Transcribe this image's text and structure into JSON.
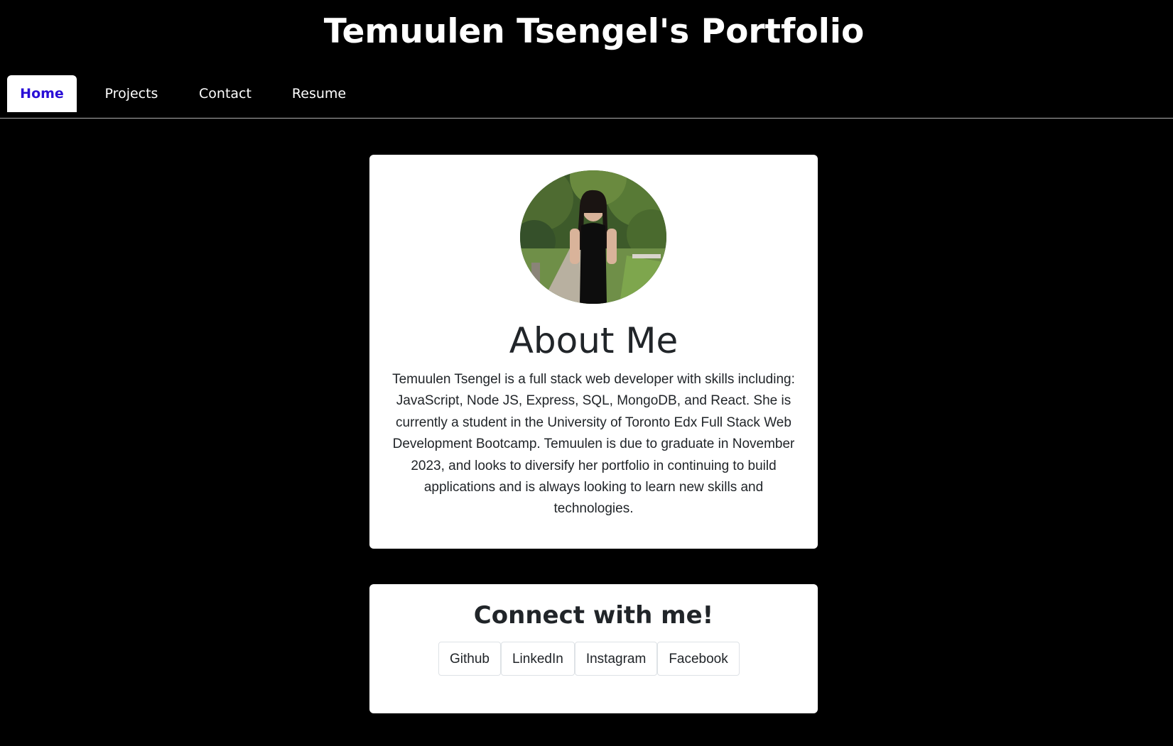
{
  "header": {
    "title": "Temuulen Tsengel's Portfolio"
  },
  "nav": {
    "tabs": [
      {
        "label": "Home",
        "active": true
      },
      {
        "label": "Projects",
        "active": false
      },
      {
        "label": "Contact",
        "active": false
      },
      {
        "label": "Resume",
        "active": false
      }
    ]
  },
  "about": {
    "heading": "About Me",
    "text": "Temuulen Tsengel is a full stack web developer with skills including: JavaScript, Node JS, Express, SQL, MongoDB, and React. She is currently a student in the University of Toronto Edx Full Stack Web Development Bootcamp. Temuulen is due to graduate in November 2023, and looks to diversify her portfolio in continuing to build applications and is always looking to learn new skills and technologies."
  },
  "connect": {
    "heading": "Connect with me!",
    "buttons": [
      "Github",
      "LinkedIn",
      "Instagram",
      "Facebook"
    ]
  },
  "colors": {
    "background": "#000000",
    "active_tab_text": "#2a0fd6",
    "card_background": "#ffffff",
    "text_dark": "#212529"
  }
}
